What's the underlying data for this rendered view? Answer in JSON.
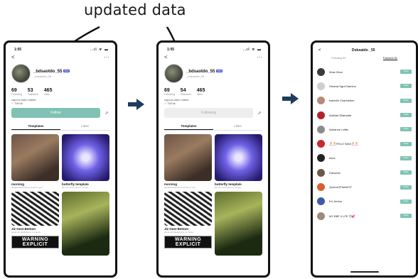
{
  "caption": "updated data",
  "phone1": {
    "time": "1:05",
    "signal": "..ıl ᯤ ▬",
    "back": "<",
    "more": "···",
    "username": "_bdsaotdo_55",
    "badge": "PRO",
    "handle": "_bdsaotdo_55",
    "stats": [
      {
        "value": "69",
        "label": "Following"
      },
      {
        "value": "53",
        "label": "Followers"
      },
      {
        "value": "465",
        "label": "Likes"
      }
    ],
    "bio1": "capcut video maker",
    "bio2": "✓ TikTok",
    "follow_label": "Follow",
    "share": "⇗",
    "tabs": [
      "Templates",
      "Likes"
    ],
    "cards": [
      {
        "title": "morning",
        "sub": "ddsafdf adaa fdf sa uf asif ro ysa"
      },
      {
        "title": "butterfly template",
        "sub": "abc ser fodrf sdrf ivs rre fgrt"
      },
      {
        "title": "Jiz Gest Bettom",
        "sub": "ddsaf dsf ddsfsdf dcs rvs fdsss"
      },
      {
        "title": "",
        "sub": ""
      }
    ],
    "warning": "WARNING EXPLICIT"
  },
  "phone2": {
    "time": "1:05",
    "signal": "..ıl ᯤ ▬",
    "back": "<",
    "more": "···",
    "username": "_bdsaotdo_55",
    "badge": "PRO",
    "handle": "_bdsaotdo_55",
    "stats": [
      {
        "value": "69",
        "label": "Following"
      },
      {
        "value": "54",
        "label": "Followers"
      },
      {
        "value": "465",
        "label": "Likes"
      }
    ],
    "bio1": "capcut video maker",
    "bio2": "✓ TikTok",
    "follow_label": "Following",
    "share": "⇗",
    "tabs": [
      "Templates",
      "Likes"
    ],
    "cards": [
      {
        "title": "morning",
        "sub": "ddsafdf adaa fdf sa uf asif ro ysa"
      },
      {
        "title": "butterfly template",
        "sub": "abc ser fodrf sdrf ivs rre fgrt"
      },
      {
        "title": "Jiz Gest Bettom",
        "sub": "ddsaf dsf ddsfsdf dcs rvs fdsss"
      },
      {
        "title": "",
        "sub": ""
      }
    ],
    "warning": "WARNING EXPLICIT"
  },
  "phone3": {
    "back": "<",
    "title": "Dsbsatdo _55",
    "tabs": [
      "Following 69",
      "Followers 54"
    ],
    "button_label": "Follow",
    "followers": [
      {
        "name": "Wow Wow",
        "color": "#3a3a3a"
      },
      {
        "name": "Obama Hgrd Namine",
        "color": "#cfcfcf"
      },
      {
        "name": "Isabelle Charlobbee",
        "color": "#b58c7a"
      },
      {
        "name": "Adelide Elfabodie",
        "color": "#b3222b"
      },
      {
        "name": "Adrianne Laffer",
        "color": "#8b8b8b"
      },
      {
        "name": "🎅🎅FELIZ NAVI🎅🎅",
        "color": "#c62c2c"
      },
      {
        "name": "elors",
        "color": "#222"
      },
      {
        "name": "Dansese",
        "color": "#6a5a4a"
      },
      {
        "name": "QueenOFNeWOT",
        "color": "#d86030"
      },
      {
        "name": "Ed Jentus",
        "color": "#3c5aa8"
      },
      {
        "name": "MY BBF 4 LFE 😊💕",
        "color": "#9c8b79"
      }
    ]
  }
}
